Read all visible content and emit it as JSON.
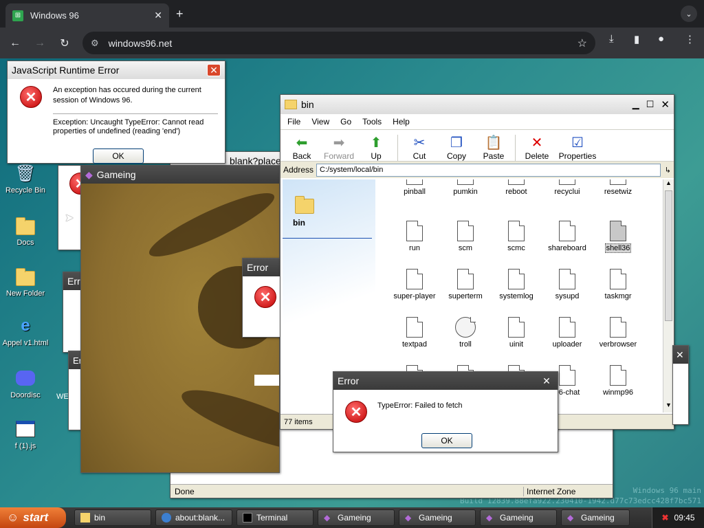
{
  "browser": {
    "tab_title": "Windows 96",
    "new_tab": "+",
    "url": "windows96.net"
  },
  "desktop": {
    "icons": [
      {
        "label": "Recycle Bin",
        "icon": "recycle-bin-icon"
      },
      {
        "label": "Docs",
        "icon": "folder-icon"
      },
      {
        "label": "New Folder",
        "icon": "folder-icon"
      },
      {
        "label": "Appel v1.html",
        "icon": "ie-icon"
      },
      {
        "label": "Doordisc",
        "icon": "discord-icon"
      },
      {
        "label": "f (1).js",
        "icon": "window-icon"
      }
    ],
    "build_line1": "Windows 96 main",
    "build_line2": "Build 12839.88efa922.230410-1942.d77c73edcc428f7bc571"
  },
  "js_error": {
    "title": "JavaScript Runtime Error",
    "message": "An exception has occured during the current session of Windows 96.",
    "detail": "Exception: Uncaught TypeError: Cannot read properties of undefined (reading 'end')",
    "ok": "OK"
  },
  "background_window": {
    "title_fragment": "blank?placehol"
  },
  "gameing_window": {
    "title": "Gameing"
  },
  "small_error": {
    "title": "Error"
  },
  "stacked_errors": {
    "title_a": "Erro",
    "title_b": "Er",
    "label_we": "WE"
  },
  "browser_statusbar": {
    "status": "Done",
    "zone": "Internet Zone"
  },
  "explorer": {
    "title": "bin",
    "menu": [
      "File",
      "View",
      "Go",
      "Tools",
      "Help"
    ],
    "toolbar": {
      "back": "Back",
      "forward": "Forward",
      "up": "Up",
      "cut": "Cut",
      "copy": "Copy",
      "paste": "Paste",
      "delete": "Delete",
      "properties": "Properties"
    },
    "address_label": "Address",
    "address": "C:/system/local/bin",
    "side_folder": "bin",
    "files": [
      "pinball",
      "pumkin",
      "reboot",
      "recyclui",
      "resetwiz",
      "run",
      "scm",
      "scmc",
      "shareboard",
      "shell36",
      "super-player",
      "superterm",
      "systemlog",
      "sysupd",
      "taskmgr",
      "textpad",
      "troll",
      "uinit",
      "uploader",
      "verbrowser",
      "",
      "",
      "",
      "96-chat",
      "winmp96"
    ],
    "item_count": "77 items"
  },
  "fetch_error": {
    "title": "Error",
    "message": "TypeError: Failed to fetch",
    "ok": "OK"
  },
  "taskbar": {
    "start": "start",
    "tasks": [
      "bin",
      "about:blank...",
      "Terminal",
      "Gameing",
      "Gameing",
      "Gameing",
      "Gameing"
    ],
    "clock": "09:45"
  }
}
